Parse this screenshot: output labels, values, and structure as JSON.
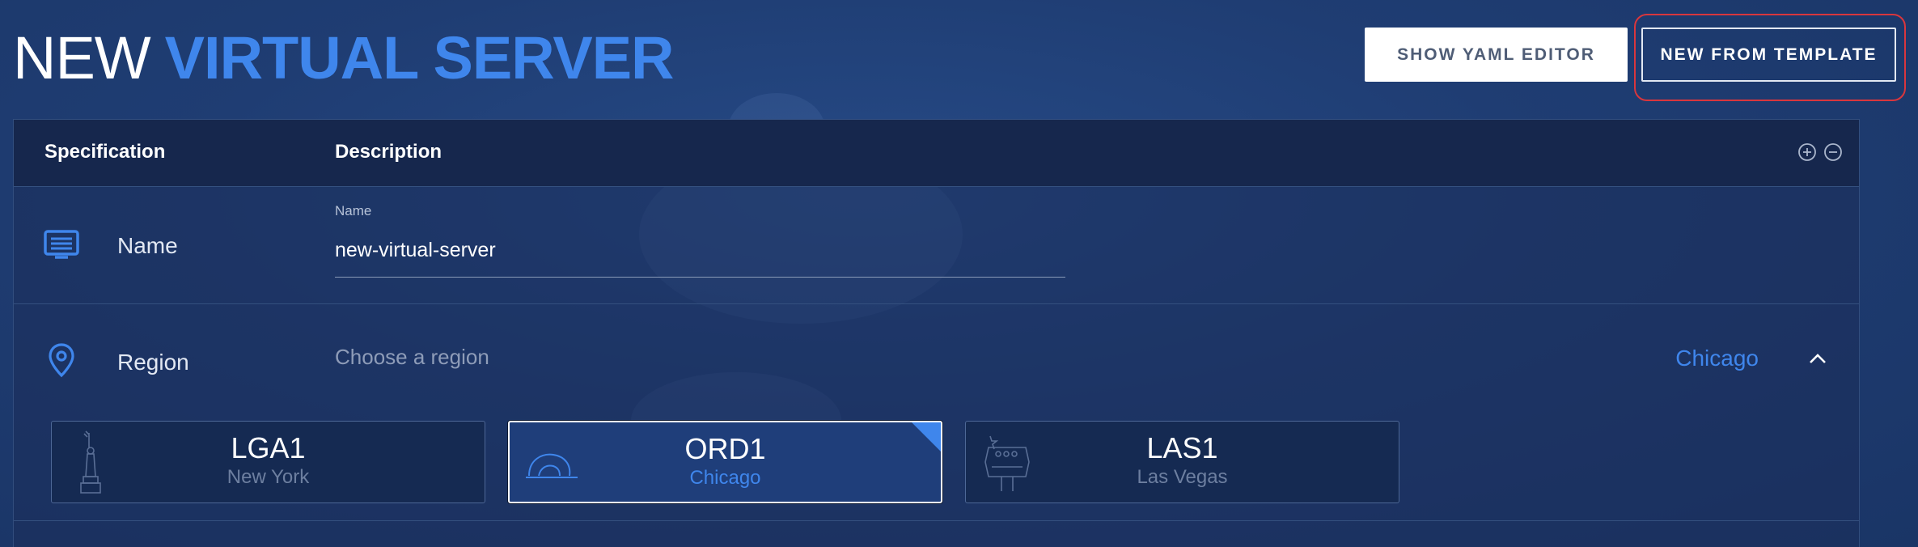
{
  "page": {
    "title_light": "NEW",
    "title_bold": "VIRTUAL SERVER"
  },
  "toolbar": {
    "yaml_label": "SHOW YAML EDITOR",
    "template_label": "NEW FROM TEMPLATE"
  },
  "table": {
    "headers": {
      "specification": "Specification",
      "description": "Description"
    },
    "header_icons": [
      "expand-all-icon",
      "collapse-all-icon"
    ]
  },
  "name_row": {
    "label": "Name",
    "icon": "server-icon",
    "field_label": "Name",
    "value": "new-virtual-server"
  },
  "region_row": {
    "label": "Region",
    "icon": "location-pin-icon",
    "placeholder": "Choose a region",
    "selected_value": "Chicago",
    "toggle_icon": "chevron-up-icon",
    "options": [
      {
        "code": "LGA1",
        "city": "New York",
        "icon": "statue-of-liberty-icon",
        "selected": false
      },
      {
        "code": "ORD1",
        "city": "Chicago",
        "icon": "cloud-gate-icon",
        "selected": true
      },
      {
        "code": "LAS1",
        "city": "Las Vegas",
        "icon": "las-vegas-sign-icon",
        "selected": false
      }
    ]
  },
  "colors": {
    "accent": "#3f86ec",
    "background": "#1f3d73",
    "header": "#16274d",
    "focus_ring": "#d9363d"
  }
}
